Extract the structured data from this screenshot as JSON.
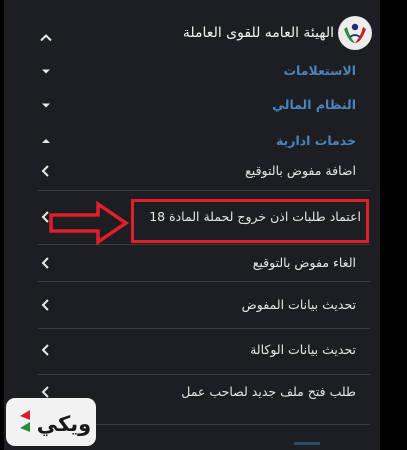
{
  "header": {
    "title": "الهيئة العامه للقوى العاملة",
    "logo_icon": "org-emblem-icon"
  },
  "menu": [
    {
      "label": "الاستعلامات",
      "type": "section"
    },
    {
      "label": "النظام المالي",
      "type": "section"
    },
    {
      "label": "خدمات ادارية",
      "type": "section"
    },
    {
      "label": "اضافة مفوض بالتوقيع",
      "type": "item"
    },
    {
      "label": "اعتماد طلبات اذن خروج لحملة المادة 18",
      "type": "item",
      "highlighted": true
    },
    {
      "label": "الغاء مفوض بالتوقيع",
      "type": "item"
    },
    {
      "label": "تحديث بيانات المفوض",
      "type": "item"
    },
    {
      "label": "تحديث بيانات الوكالة",
      "type": "item"
    },
    {
      "label": "طلب فتح ملف جديد لصاحب عمل",
      "type": "item"
    }
  ],
  "watermark": {
    "text": "ويكي"
  },
  "colors": {
    "panel_bg": "#1c1e22",
    "section_text": "#4c84be",
    "item_text": "#e6e6e6",
    "highlight": "#e01f2a",
    "divider": "#3a3d42"
  }
}
